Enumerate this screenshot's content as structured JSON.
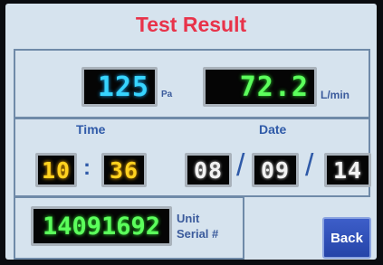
{
  "screen": {
    "title": "Test Result",
    "pressure": {
      "value": "125",
      "unit": "Pa"
    },
    "flow": {
      "value": "72.2",
      "unit": "L/min"
    },
    "time": {
      "label": "Time",
      "hour": "10",
      "minute": "36",
      "separator": ":"
    },
    "date": {
      "label": "Date",
      "day": "08",
      "month": "09",
      "year": "14",
      "separator": "/"
    },
    "serial": {
      "value": "14091692",
      "label_line1": "Unit",
      "label_line2": "Serial #"
    },
    "back_button": "Back"
  },
  "colors": {
    "background": "#d6e3ee",
    "title": "#e8334a",
    "label": "#2f5aa8",
    "pressure_digits": "#37d4ff",
    "flow_digits": "#5cff5c",
    "time_digits": "#ffd21f",
    "date_digits": "#f2f2f2",
    "serial_digits": "#5cff5c",
    "button": "#2f4fb8"
  }
}
